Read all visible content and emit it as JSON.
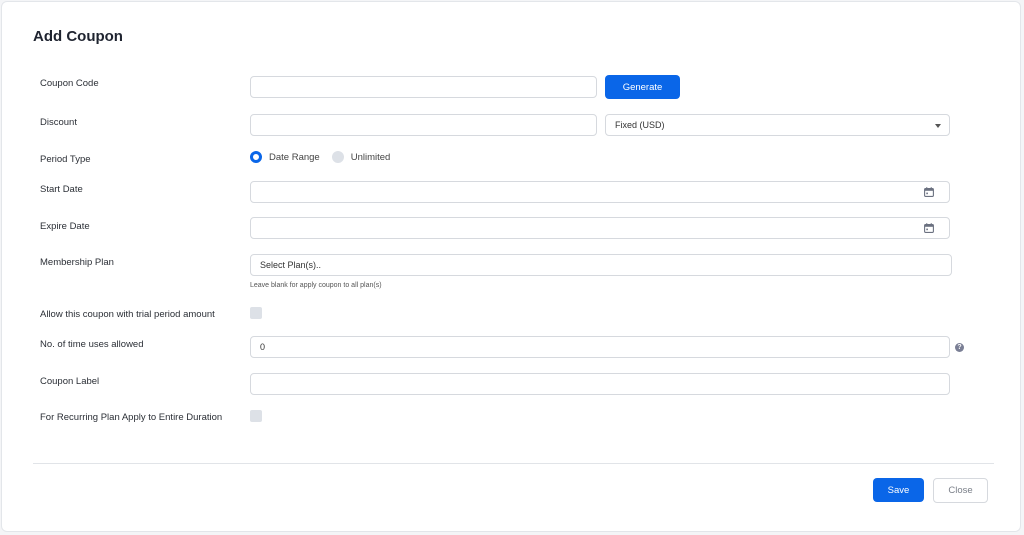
{
  "title": "Add Coupon",
  "fields": {
    "coupon_code": {
      "label": "Coupon Code",
      "value": ""
    },
    "generate_label": "Generate",
    "discount": {
      "label": "Discount",
      "value": "",
      "type_selected": "Fixed (USD)"
    },
    "period_type": {
      "label": "Period Type",
      "options": [
        "Date Range",
        "Unlimited"
      ],
      "selected": "Date Range"
    },
    "start_date": {
      "label": "Start Date",
      "value": ""
    },
    "expire_date": {
      "label": "Expire Date",
      "value": ""
    },
    "membership_plan": {
      "label": "Membership Plan",
      "placeholder": "Select Plan(s)..",
      "hint": "Leave blank for apply coupon to all plan(s)"
    },
    "trial_period": {
      "label": "Allow this coupon with trial period amount",
      "checked": false
    },
    "uses_allowed": {
      "label": "No. of time uses allowed",
      "value": "0",
      "help_icon": "?"
    },
    "coupon_label": {
      "label": "Coupon Label",
      "value": ""
    },
    "recurring": {
      "label": "For Recurring Plan Apply to Entire Duration",
      "checked": false
    }
  },
  "footer": {
    "save_label": "Save",
    "close_label": "Close"
  },
  "icons": {
    "calendar": "calendar-icon",
    "dropdown": "chevron-down-icon",
    "help": "help-icon"
  },
  "colors": {
    "primary": "#0a66e8",
    "radio_off": "#dde1e7",
    "checkbox": "#dde1e7"
  }
}
